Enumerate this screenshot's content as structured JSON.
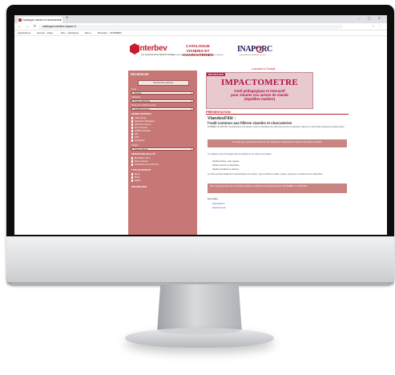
{
  "browser": {
    "tab_title": "Catalogue viandes et charcuteries",
    "new_tab_glyph": "+",
    "window_controls": "– ▢ ✕",
    "nav_glyphs": "← → ⟳",
    "url": "catalogue-interbev-inaporc.fr",
    "ext_glyphs": "☆ ⋮",
    "bookmarks": [
      "Applications",
      "Accueil – Page",
      "Site – Catalogue",
      "Menu",
      "Recettes – INTERBEV"
    ]
  },
  "header": {
    "interbev_name": "interbev",
    "interbev_sub": "Les Interprofessions Bétail & Viandes",
    "catalogue_title_1": "CATALOGUE",
    "catalogue_title_2": "VIANDES ET CHARCUTERIES",
    "catalogue_sub": "Un outil d'aide pour les professionnels de la restauration collective",
    "inaporc_name": "INAPORC",
    "inaporc_sub": "Interprofession Nationale Porcine",
    "dots": "● Accueil ● Contact"
  },
  "sidebar": {
    "heading": "RECHERCHE",
    "search_button": "Recherche avancée",
    "label_type": "Type",
    "select_type": "Viandes",
    "label_category": "Catégorie",
    "select_category": "Toutes catégories",
    "label_mode": "Mode de conditionnement",
    "select_mode": "Conditionnement",
    "label_labels": "SIGNES OFFICIELS",
    "checks_1": [
      "Label Rouge",
      "Agriculture Biologique",
      "Viande de France",
      "Porc Français",
      "Volaille Française",
      "IGP",
      "AOP",
      "Appellation"
    ],
    "label_origin": "Origine",
    "select_origin": "Toutes origines",
    "label_qualities": "DÉMARCHES QUALITÉ",
    "checks_2": [
      "Bleu Blanc Cœur",
      "Race à viande",
      "Certification de conformité"
    ],
    "label_cuts": "TYPE DE PRODUIT",
    "checks_3": [
      "Entier",
      "Piécé",
      "Haché"
    ],
    "footer_label": "RECHERCHER"
  },
  "content": {
    "banner_tag": "NOUVEAUTÉ",
    "banner_title": "IMPACTOMETRE",
    "banner_sub_1": "Outil pédagogique et interactif",
    "banner_sub_2": "pour simuler ses achats de viande",
    "banner_sub_3": "(équilibre matière)",
    "section_title": "PRÉSENTATION",
    "heading": "ViandesFiliè :",
    "subheading": "l'outil commun aux filières viandes et charcuteries",
    "para_1": "INTERBEV et INAPORC, interprofessions des viandes, mettent à disposition des professionnels de la restauration collective un outil d'aide à l'achat des produits carnés.",
    "highlight": "Cet outil vous permet de découvrir les viandes et charcuteries à travers des fiches produits.",
    "para_2": "Ce catalogue vous accompagne dans la rédaction de vos cahiers des charges :",
    "bullets": [
      "Viandes bovines, veau, agneau",
      "Viandes de porc et charcuteries",
      "Viandes chevalines et caprines"
    ],
    "para_3": "Les fiches produits détaillent les caractéristiques des viandes : signes officiels de qualité, origines, découpes et conditionnements disponibles.",
    "pink_note": "Pour toute question sur les fiches produits, contactez les interprofessions INTERBEV et INAPORC.",
    "links_title": "Liens utiles :",
    "link_1": "www.interbev.fr",
    "link_2": "www.leporc.com"
  }
}
